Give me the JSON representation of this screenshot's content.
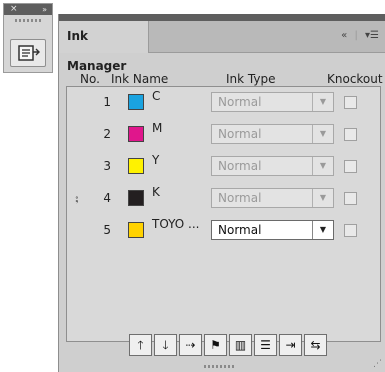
{
  "dock": {
    "close_glyph": "×",
    "collapse_glyph": "»",
    "button_icon": "ink-manager-icon"
  },
  "panel": {
    "tab_title": "Ink Manager",
    "collapse_glyph": "«",
    "menu_glyph": "▾☰"
  },
  "columns": {
    "no": "No.",
    "ink_name": "Ink Name",
    "ink_type": "Ink Type",
    "knockout": "Knockout"
  },
  "inks": [
    {
      "no": "1",
      "name": "C",
      "color": "#1aa3e0",
      "type": "Normal",
      "enabled": false,
      "proof": ""
    },
    {
      "no": "2",
      "name": "M",
      "color": "#e0168c",
      "type": "Normal",
      "enabled": false,
      "proof": ""
    },
    {
      "no": "3",
      "name": "Y",
      "color": "#fff200",
      "type": "Normal",
      "enabled": false,
      "proof": ""
    },
    {
      "no": "4",
      "name": "K",
      "color": "#231f20",
      "type": "Normal",
      "enabled": false,
      "proof": "⨟"
    },
    {
      "no": "5",
      "name": "TOYO ...",
      "color": "#ffd200",
      "type": "Normal",
      "enabled": true,
      "proof": ""
    }
  ],
  "toolbar": [
    {
      "icon": "move-up-icon",
      "glyph": "🡑"
    },
    {
      "icon": "move-down-icon",
      "glyph": "🡓"
    },
    {
      "icon": "ink-alias-icon",
      "glyph": "⇢"
    },
    {
      "icon": "proof-icon",
      "glyph": "⚑"
    },
    {
      "icon": "ink-levels-icon",
      "glyph": "▥"
    },
    {
      "icon": "ink-list-icon",
      "glyph": "☰"
    },
    {
      "icon": "merge-ink-icon",
      "glyph": "⇥"
    },
    {
      "icon": "convert-ink-icon",
      "glyph": "⇆"
    }
  ],
  "resize_glyph": "⋰"
}
